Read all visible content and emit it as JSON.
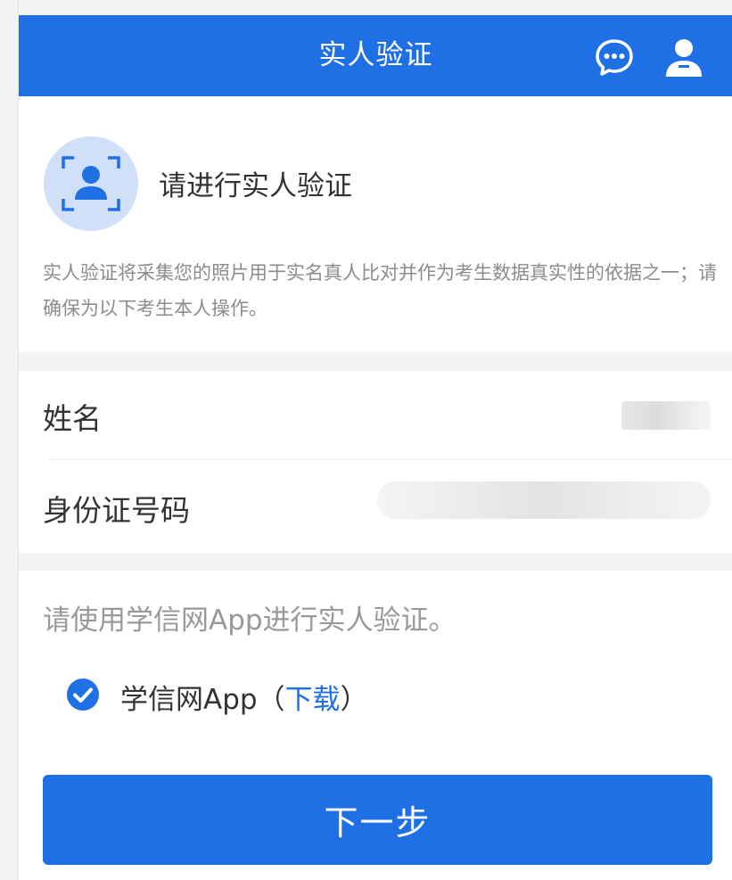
{
  "header": {
    "title": "实人验证",
    "chat_icon": "chat-bubble-icon",
    "user_icon": "user-icon"
  },
  "intro": {
    "icon": "face-scan-icon",
    "heading": "请进行实人验证",
    "description": "实人验证将采集您的照片用于实名真人比对并作为考生数据真实性的依据之一；请确保为以下考生本人操作。"
  },
  "fields": {
    "name_label": "姓名",
    "id_label": "身份证号码"
  },
  "method": {
    "instruction": "请使用学信网App进行实人验证。",
    "option_label": "学信网App（",
    "option_link": "下载",
    "option_close": "）",
    "checkbox_icon": "check-circle-icon"
  },
  "next_button": "下一步",
  "colors": {
    "primary": "#1f6fe5",
    "avatar_bg": "#cfe0f8",
    "description_text": "#8c8c8c"
  }
}
